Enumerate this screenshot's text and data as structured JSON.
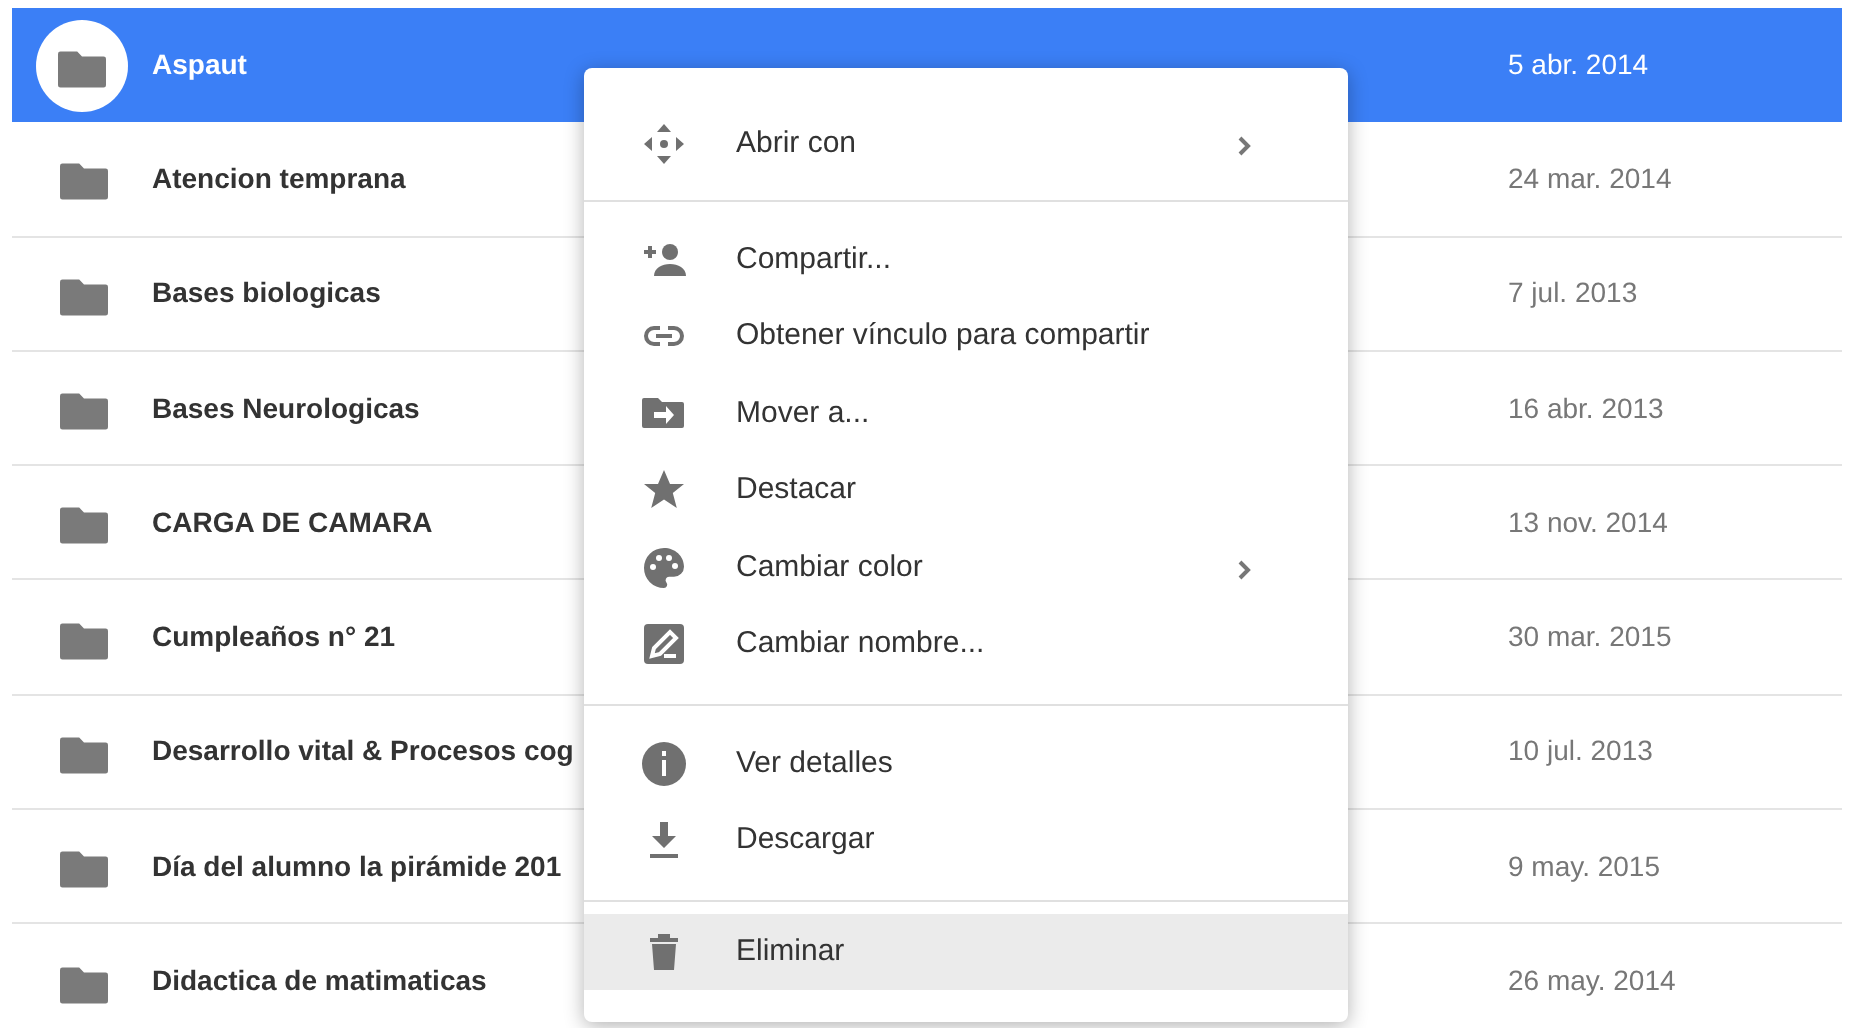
{
  "files": [
    {
      "name": "Aspaut",
      "date": "5 abr. 2014",
      "selected": true
    },
    {
      "name": "Atencion temprana",
      "date": "24 mar. 2014",
      "selected": false
    },
    {
      "name": "Bases biologicas",
      "date": "7 jul. 2013",
      "selected": false
    },
    {
      "name": "Bases Neurologicas",
      "date": "16 abr. 2013",
      "selected": false
    },
    {
      "name": "CARGA DE CAMARA",
      "date": "13 nov. 2014",
      "selected": false
    },
    {
      "name": "Cumpleaños n° 21",
      "date": "30 mar. 2015",
      "selected": false
    },
    {
      "name": "Desarrollo vital & Procesos cog",
      "date": "10 jul. 2013",
      "selected": false
    },
    {
      "name": "Día del alumno la pirámide 201",
      "date": "9 may. 2015",
      "selected": false
    },
    {
      "name": "Didactica de matimaticas",
      "date": "26 may. 2014",
      "selected": false
    }
  ],
  "context_menu": {
    "sections": [
      [
        {
          "kind": "move",
          "label": "Abrir con",
          "submenu": true,
          "highlighted": false
        }
      ],
      [
        {
          "kind": "person-add",
          "label": "Compartir...",
          "submenu": false,
          "highlighted": false
        },
        {
          "kind": "link",
          "label": "Obtener vínculo para compartir",
          "submenu": false,
          "highlighted": false
        },
        {
          "kind": "folder-move",
          "label": "Mover a...",
          "submenu": false,
          "highlighted": false
        },
        {
          "kind": "star",
          "label": "Destacar",
          "submenu": false,
          "highlighted": false
        },
        {
          "kind": "palette",
          "label": "Cambiar color",
          "submenu": true,
          "highlighted": false
        },
        {
          "kind": "rename",
          "label": "Cambiar nombre...",
          "submenu": false,
          "highlighted": false
        }
      ],
      [
        {
          "kind": "info",
          "label": "Ver detalles",
          "submenu": false,
          "highlighted": false
        },
        {
          "kind": "download",
          "label": "Descargar",
          "submenu": false,
          "highlighted": false
        }
      ],
      [
        {
          "kind": "trash",
          "label": "Eliminar",
          "submenu": false,
          "highlighted": true
        }
      ]
    ]
  }
}
